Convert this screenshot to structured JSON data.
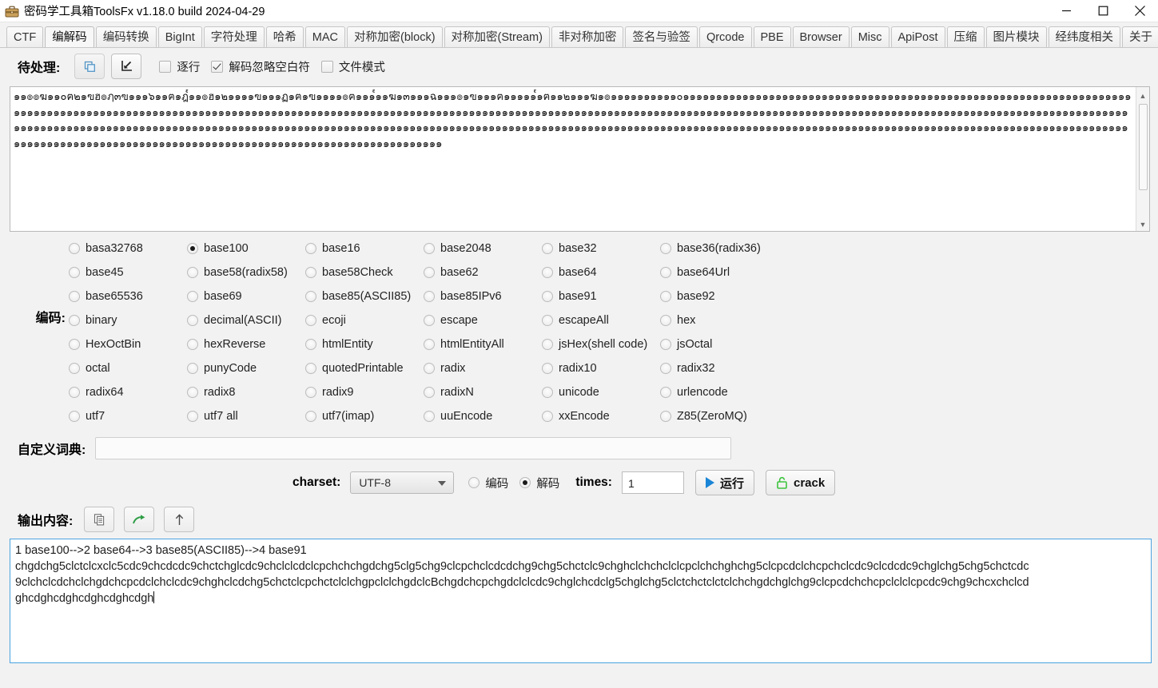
{
  "window": {
    "title": "密码学工具箱ToolsFx v1.18.0 build 2024-04-29",
    "icon": "toolbox-icon",
    "minimize": "minimize-icon",
    "maximize": "maximize-icon",
    "close": "close-icon"
  },
  "tabs": [
    {
      "label": "CTF",
      "active": false
    },
    {
      "label": "编解码",
      "active": true
    },
    {
      "label": "编码转换",
      "active": false
    },
    {
      "label": "BigInt",
      "active": false
    },
    {
      "label": "字符处理",
      "active": false
    },
    {
      "label": "哈希",
      "active": false
    },
    {
      "label": "MAC",
      "active": false
    },
    {
      "label": "对称加密(block)",
      "active": false
    },
    {
      "label": "对称加密(Stream)",
      "active": false
    },
    {
      "label": "非对称加密",
      "active": false
    },
    {
      "label": "签名与验签",
      "active": false
    },
    {
      "label": "Qrcode",
      "active": false
    },
    {
      "label": "PBE",
      "active": false
    },
    {
      "label": "Browser",
      "active": false
    },
    {
      "label": "Misc",
      "active": false
    },
    {
      "label": "ApiPost",
      "active": false
    },
    {
      "label": "压缩",
      "active": false
    },
    {
      "label": "图片模块",
      "active": false
    },
    {
      "label": "经纬度相关",
      "active": false
    },
    {
      "label": "关于",
      "active": false
    }
  ],
  "pending": {
    "label": "待处理:",
    "copy_button_icon": "copy-icon",
    "paste_button_icon": "import-arrow-icon",
    "options": [
      {
        "label": "逐行",
        "checked": false
      },
      {
        "label": "解码忽略空白符",
        "checked": true
      },
      {
        "label": "文件模式",
        "checked": false
      }
    ]
  },
  "input": {
    "content": "๑๑๏๏ฆ๑๑๐ฅ๒๑ฃฮ๏ฦ๓ฃ๑๑๑๖๑๑ฅ๑ฎ๎๑๑๏ฮ๑๒๑๑๑๑ฃ๑๑๑ฏ๑ฅ๑ฃ๑๑๑๑๏ฅ๑๑๑๎๑๑ฆ๑๓๑๑๑ฉ๑๑๑๏๑ฃ๑๑๑ฅ๑๑๑๑๑๎๑ฅ๑๑๒๑๑๑ฆ๑๏๑๑๑๑๑๑๑๑๑๑๐๑๑๑๑๑๑๑๑๑๑๑๑๑๑๑๑๑๑๑๑๑๑๑๑๑๑๑๑๑๑๑๑๑๑๑๑๑๑๑๑๑๑๑๑๑๑๑๑๑๑๑๑๑๑๑๑๑๑๑๑๑๑๑๑๑๑๑๑๑๑๑๑๑๑๑๑๑๑๑๑๑๑๑๑๑๑๑๑๑๑๑๑๑๑๑๑๑๑๑๑๑๑๑๑๑๑๑๑๑๑๑๑๑๑๑๑๑๑๑๑๑๑๑๑๑๑๑๑๑๑๑๑๑๑๑๑๑๑๑๑๑๑๑๑๑๑๑๑๑๑๑๑๑๑๑๑๑๑๑๑๑๑๑๑๑๑๑๑๑๑๑๑๑๑๑๑๑๑๑๑๑๑๑๑๑๑๑๑๑๑๑๑๑๑๑๑๑๑๑๑๑๑๑๑๑๑๑๑๑๑๑๑๑๑๑๑๑๑๑๑๑๑๑๑๑๑๑๑๑๑๑๑๑๑๑๑๑๑๑๑๑๑๑๑๑๑๑๑๑๑๑๑๑๑๑๑๑๑๑๑๑๑๑๑๑๑๑๑๑๑๑๑๑๑๑๑๑๑๑๑๑๑๑๑๑๑๑๑๑๑๑๑๑๑๑๑๑๑๑๑๑๑๑๑๑๑๑๑๑๑๑๑๑๑๑๑๑๑๑๑๑๑๑๑๑๑๑๑๑๑๑๑๑๑๑๑๑๑๑๑๑๑๑๑๑๑๑๑๑๑๑๑๑๑๑๑๑๑๑๑๑๑๑๑๑๑๑๑๑๑๑๑๑๑๑๑๑๑๑๑๑๑๑๑๑๑๑๑๑๑๑๑๑๑๑๑๑๑๑๑๑๑๑๑๑๑๑๑๑๑๑๑๑๑๑๑๑๑๑๑๑๑๑๑๑๑๑๑๑๑๑๑๑๑๑๑๑๑๑๑๑๑๑๑๑๑๑๑๑๑๑๑๑๑๑๑๑๑๑๑๑๑๑๑๑๑๑๑๑๑๑",
    "scrollbar": {
      "up_arrow": "scroll-up-icon",
      "down_arrow": "scroll-down-icon"
    }
  },
  "encoding": {
    "label": "编码:",
    "selected": "base100",
    "options": [
      "basa32768",
      "base100",
      "base16",
      "base2048",
      "base32",
      "base36(radix36)",
      "base45",
      "base58(radix58)",
      "base58Check",
      "base62",
      "base64",
      "base64Url",
      "base65536",
      "base69",
      "base85(ASCII85)",
      "base85IPv6",
      "base91",
      "base92",
      "binary",
      "decimal(ASCII)",
      "ecoji",
      "escape",
      "escapeAll",
      "hex",
      "HexOctBin",
      "hexReverse",
      "htmlEntity",
      "htmlEntityAll",
      "jsHex(shell code)",
      "jsOctal",
      "octal",
      "punyCode",
      "quotedPrintable",
      "radix",
      "radix10",
      "radix32",
      "radix64",
      "radix8",
      "radix9",
      "radixN",
      "unicode",
      "urlencode",
      "utf7",
      "utf7 all",
      "utf7(imap)",
      "uuEncode",
      "xxEncode",
      "Z85(ZeroMQ)"
    ]
  },
  "dictionary": {
    "label": "自定义词典:",
    "value": "",
    "placeholder": ""
  },
  "controls": {
    "charset_label": "charset:",
    "charset_value": "UTF-8",
    "mode_options": [
      {
        "label": "编码",
        "selected": false
      },
      {
        "label": "解码",
        "selected": true
      }
    ],
    "times_label": "times:",
    "times_value": "1",
    "run_button": "运行",
    "run_icon": "play-icon",
    "crack_button": "crack",
    "crack_icon": "unlock-icon"
  },
  "output": {
    "label": "输出内容:",
    "buttons": [
      {
        "icon": "copy-icon",
        "name": "copy-output-button"
      },
      {
        "icon": "share-arrow-icon",
        "name": "send-output-button"
      },
      {
        "icon": "up-arrow-icon",
        "name": "move-up-button"
      }
    ],
    "lines": [
      "1 base100-->2 base64-->3 base85(ASCII85)-->4 base91",
      "chgdchg5clctclcxclc5cdc9chcdcdc9chctchglcdc9chclclcdclcpchchchgdchg5clg5chg9clcpchclcdcdchg9chg5chctclc9chghclchchclclcpclchchghchg5clcpcdclchcpchclcdc9clcdcdc9chglchg5chg5chctcdc",
      "9clchclcdchclchgdchcpcdclchclcdc9chghclcdchg5chctclcpchctclclchgpclclchgdclcBchgdchcpchgdclclcdc9chglchcdclg5chglchg5clctchctclctclchchgdchglchg9clcpcdchchcpclclclcpcdc9chg9chcxchclcd",
      "ghcdghcdghcdghcdghcdgh"
    ]
  }
}
